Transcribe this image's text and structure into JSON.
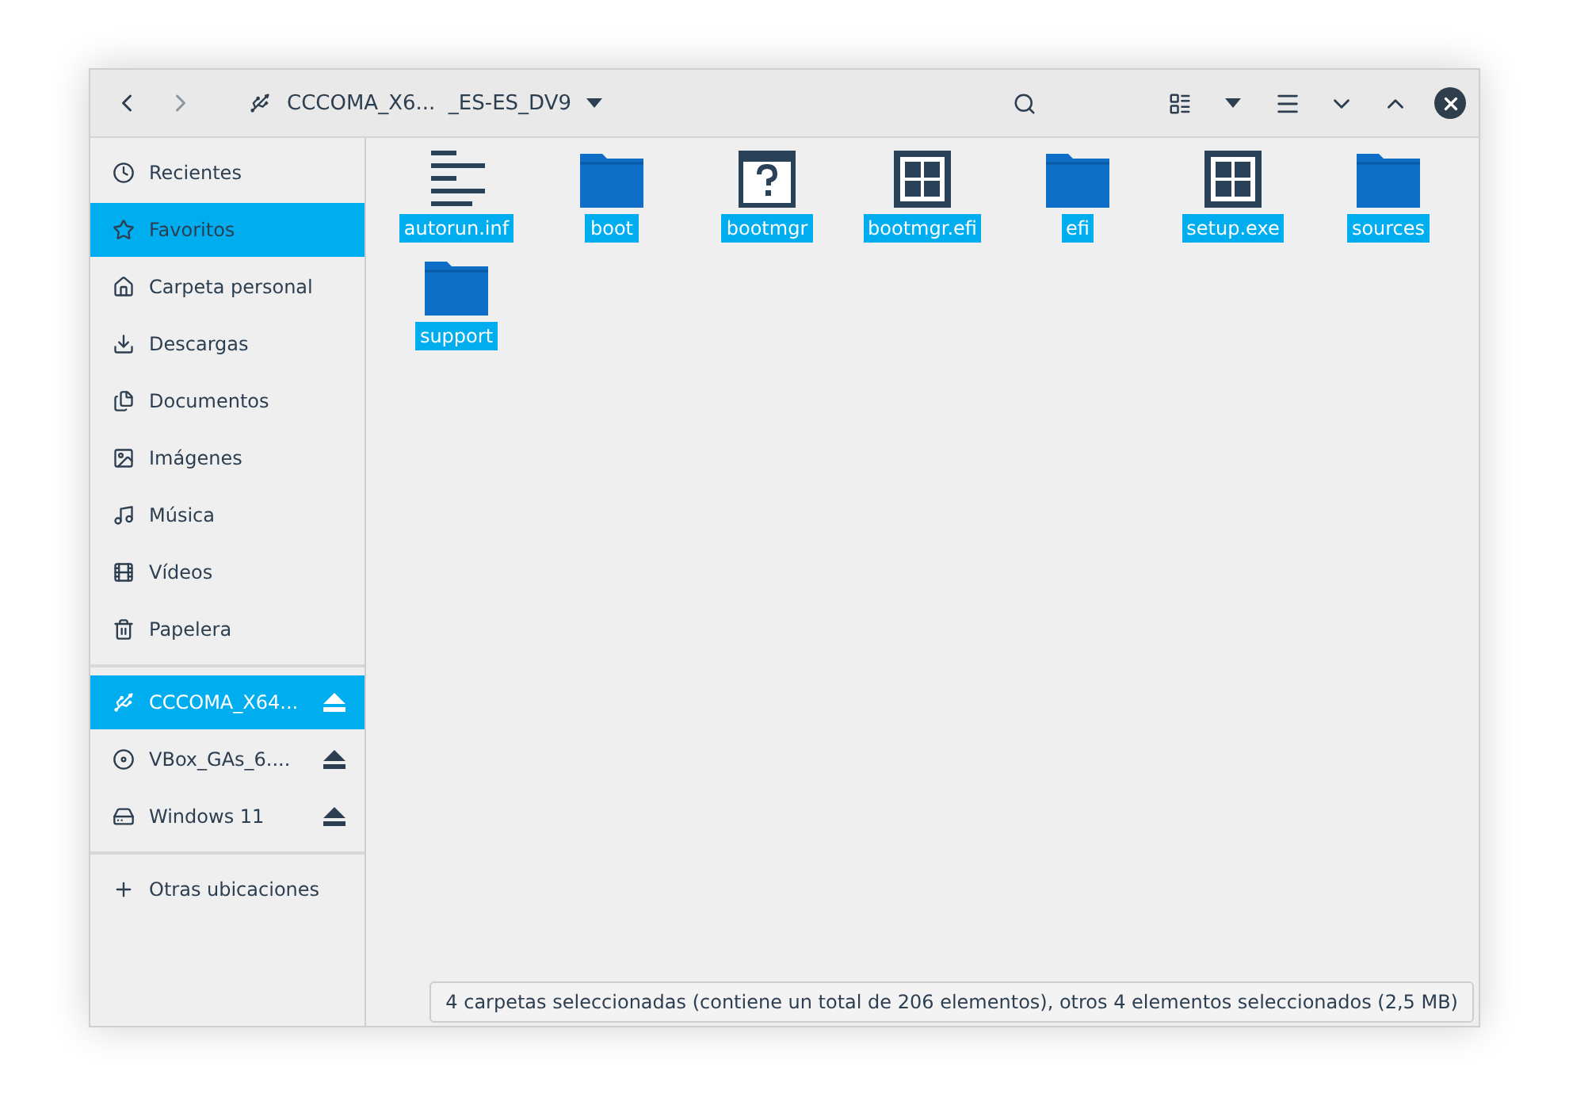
{
  "header": {
    "path": "CCCOMA_X6...  _ES-ES_DV9"
  },
  "sidebar": {
    "sections": [
      {
        "items": [
          {
            "label": "Recientes",
            "selected": false
          },
          {
            "label": "Favoritos",
            "selected": true
          },
          {
            "label": "Carpeta personal",
            "selected": false
          },
          {
            "label": "Descargas",
            "selected": false
          },
          {
            "label": "Documentos",
            "selected": false
          },
          {
            "label": "Imágenes",
            "selected": false
          },
          {
            "label": "Música",
            "selected": false
          },
          {
            "label": "Vídeos",
            "selected": false
          },
          {
            "label": "Papelera",
            "selected": false
          }
        ]
      },
      {
        "items": [
          {
            "label": "CCCOMA_X64...",
            "selected": true,
            "ejectable": true
          },
          {
            "label": "VBox_GAs_6....",
            "selected": false,
            "ejectable": true
          },
          {
            "label": "Windows 11",
            "selected": false,
            "ejectable": true
          }
        ]
      },
      {
        "items": [
          {
            "label": "Otras ubicaciones",
            "selected": false
          }
        ]
      }
    ]
  },
  "files": [
    {
      "name": "autorun.inf",
      "kind": "text",
      "selected": true
    },
    {
      "name": "boot",
      "kind": "folder",
      "selected": true
    },
    {
      "name": "bootmgr",
      "kind": "unknown",
      "selected": true
    },
    {
      "name": "bootmgr.efi",
      "kind": "app",
      "selected": true
    },
    {
      "name": "efi",
      "kind": "folder",
      "selected": true
    },
    {
      "name": "setup.exe",
      "kind": "app",
      "selected": true
    },
    {
      "name": "sources",
      "kind": "folder",
      "selected": true
    },
    {
      "name": "support",
      "kind": "folder",
      "selected": true
    }
  ],
  "status_bar": "4 carpetas seleccionadas (contiene un total de 206 elementos), otros 4 elementos seleccionados (2,5 MB)"
}
